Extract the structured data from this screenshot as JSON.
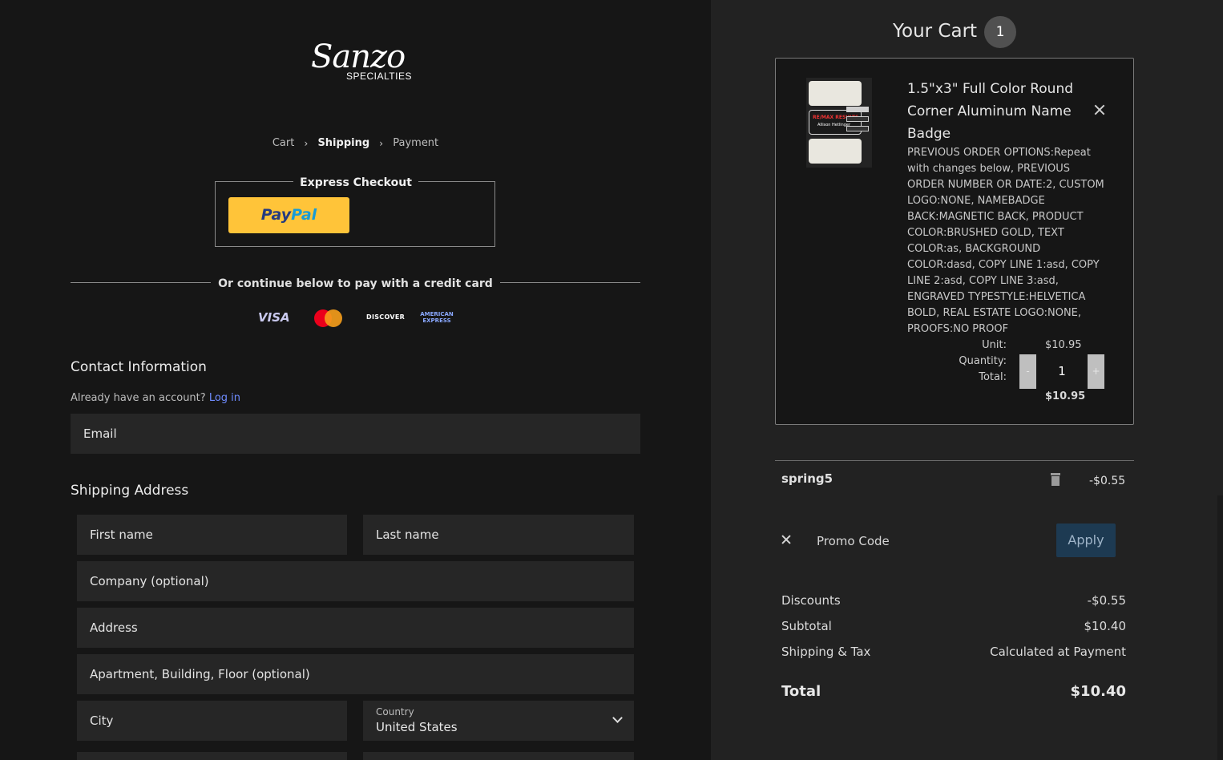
{
  "logo": {
    "script": "Sanzo",
    "sub": "SPECIALTIES"
  },
  "breadcrumb": [
    "Cart",
    "Shipping",
    "Payment"
  ],
  "express": {
    "label": "Express Checkout",
    "paypal_a": "Pay",
    "paypal_b": "Pal"
  },
  "or_text": "Or continue below to pay with a credit card",
  "cards": {
    "visa": "VISA",
    "discover": "DISCOVER",
    "amex_1": "AMERICAN",
    "amex_2": "EXPRESS"
  },
  "contact": {
    "title": "Contact Information",
    "have_account": "Already have an account?",
    "login": "Log in",
    "email_placeholder": "Email"
  },
  "shipping": {
    "title": "Shipping Address",
    "first_name": "First name",
    "last_name": "Last name",
    "company": "Company (optional)",
    "address": "Address",
    "apartment": "Apartment, Building, Floor (optional)",
    "city": "City",
    "country_label": "Country",
    "country_value": "United States"
  },
  "cart": {
    "title": "Your Cart",
    "count": "1",
    "item": {
      "name": "1.5\"x3\" Full Color Round Corner Aluminum Name Badge",
      "options": "PREVIOUS ORDER OPTIONS:Repeat with changes below, PREVIOUS ORDER NUMBER OR DATE:2, CUSTOM LOGO:NONE, NAMEBADGE BACK:MAGNETIC BACK, PRODUCT COLOR:BRUSHED GOLD, TEXT COLOR:as, BACKGROUND COLOR:dasd, COPY LINE 1:asd, COPY LINE 2:asd, COPY LINE 3:asd, ENGRAVED TYPESTYLE:HELVETICA BOLD, REAL ESTATE LOGO:NONE, PROOFS:NO PROOF",
      "unit_label": "Unit:",
      "unit_value": "$10.95",
      "qty_label": "Quantity:",
      "qty_value": "1",
      "total_label": "Total:",
      "total_value": "$10.95",
      "minus": "-",
      "plus": "+",
      "thumb_text_1": "RE/MAX RESULTS",
      "thumb_text_2": "Allison Hetlinger"
    },
    "promo_applied": {
      "code": "spring5",
      "amount": "-$0.55"
    },
    "promo_input_placeholder": "Promo Code",
    "apply_label": "Apply",
    "summary": [
      {
        "key": "Discounts",
        "value": "-$0.55"
      },
      {
        "key": "Subtotal",
        "value": "$10.40"
      },
      {
        "key": "Shipping & Tax",
        "value": "Calculated at Payment"
      }
    ],
    "total": {
      "key": "Total",
      "value": "$10.40"
    }
  },
  "colors": {
    "paypal_yellow": "#ffc439",
    "link_blue": "#6f8cff",
    "apply_bg": "#1d3a52"
  }
}
